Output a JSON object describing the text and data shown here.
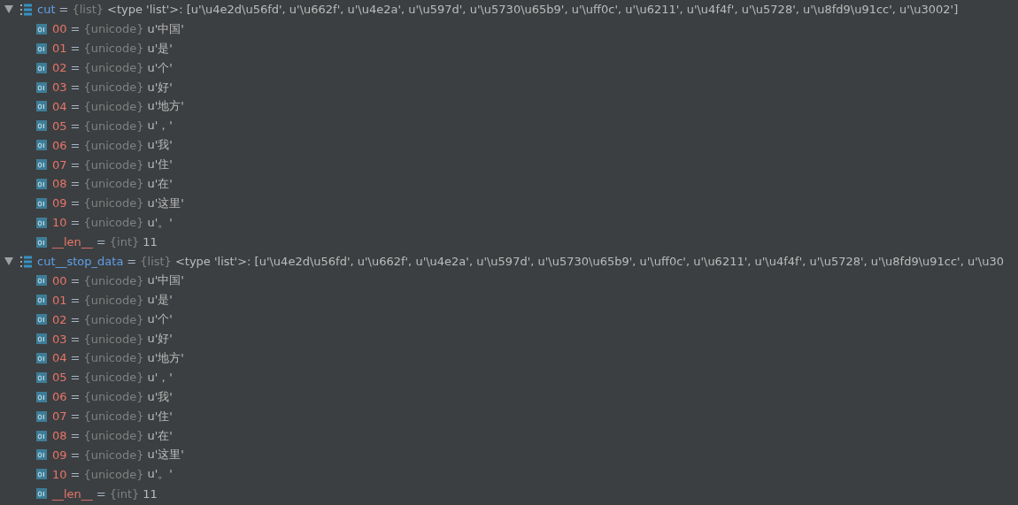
{
  "variables": [
    {
      "name": "cut",
      "separator": "=",
      "type": "{list}",
      "value": "<type 'list'>: [u'\\u4e2d\\u56fd', u'\\u662f', u'\\u4e2a', u'\\u597d', u'\\u5730\\u65b9', u'\\uff0c', u'\\u6211', u'\\u4f4f', u'\\u5728', u'\\u8fd9\\u91cc', u'\\u3002']",
      "expanded": true,
      "children": [
        {
          "name": "00",
          "separator": "=",
          "type": "{unicode}",
          "value": "u'中国'"
        },
        {
          "name": "01",
          "separator": "=",
          "type": "{unicode}",
          "value": "u'是'"
        },
        {
          "name": "02",
          "separator": "=",
          "type": "{unicode}",
          "value": "u'个'"
        },
        {
          "name": "03",
          "separator": "=",
          "type": "{unicode}",
          "value": "u'好'"
        },
        {
          "name": "04",
          "separator": "=",
          "type": "{unicode}",
          "value": "u'地方'"
        },
        {
          "name": "05",
          "separator": "=",
          "type": "{unicode}",
          "value": "u'，'"
        },
        {
          "name": "06",
          "separator": "=",
          "type": "{unicode}",
          "value": "u'我'"
        },
        {
          "name": "07",
          "separator": "=",
          "type": "{unicode}",
          "value": "u'住'"
        },
        {
          "name": "08",
          "separator": "=",
          "type": "{unicode}",
          "value": "u'在'"
        },
        {
          "name": "09",
          "separator": "=",
          "type": "{unicode}",
          "value": "u'这里'"
        },
        {
          "name": "10",
          "separator": "=",
          "type": "{unicode}",
          "value": "u'。'"
        },
        {
          "name": "__len__",
          "separator": "=",
          "type": "{int}",
          "value": "11"
        }
      ]
    },
    {
      "name": "cut__stop_data",
      "separator": "=",
      "type": "{list}",
      "value": "<type 'list'>: [u'\\u4e2d\\u56fd', u'\\u662f', u'\\u4e2a', u'\\u597d', u'\\u5730\\u65b9', u'\\uff0c', u'\\u6211', u'\\u4f4f', u'\\u5728', u'\\u8fd9\\u91cc', u'\\u30",
      "expanded": true,
      "children": [
        {
          "name": "00",
          "separator": "=",
          "type": "{unicode}",
          "value": "u'中国'"
        },
        {
          "name": "01",
          "separator": "=",
          "type": "{unicode}",
          "value": "u'是'"
        },
        {
          "name": "02",
          "separator": "=",
          "type": "{unicode}",
          "value": "u'个'"
        },
        {
          "name": "03",
          "separator": "=",
          "type": "{unicode}",
          "value": "u'好'"
        },
        {
          "name": "04",
          "separator": "=",
          "type": "{unicode}",
          "value": "u'地方'"
        },
        {
          "name": "05",
          "separator": "=",
          "type": "{unicode}",
          "value": "u'，'"
        },
        {
          "name": "06",
          "separator": "=",
          "type": "{unicode}",
          "value": "u'我'"
        },
        {
          "name": "07",
          "separator": "=",
          "type": "{unicode}",
          "value": "u'住'"
        },
        {
          "name": "08",
          "separator": "=",
          "type": "{unicode}",
          "value": "u'在'"
        },
        {
          "name": "09",
          "separator": "=",
          "type": "{unicode}",
          "value": "u'这里'"
        },
        {
          "name": "10",
          "separator": "=",
          "type": "{unicode}",
          "value": "u'。'"
        },
        {
          "name": "__len__",
          "separator": "=",
          "type": "{int}",
          "value": "11"
        }
      ]
    }
  ]
}
